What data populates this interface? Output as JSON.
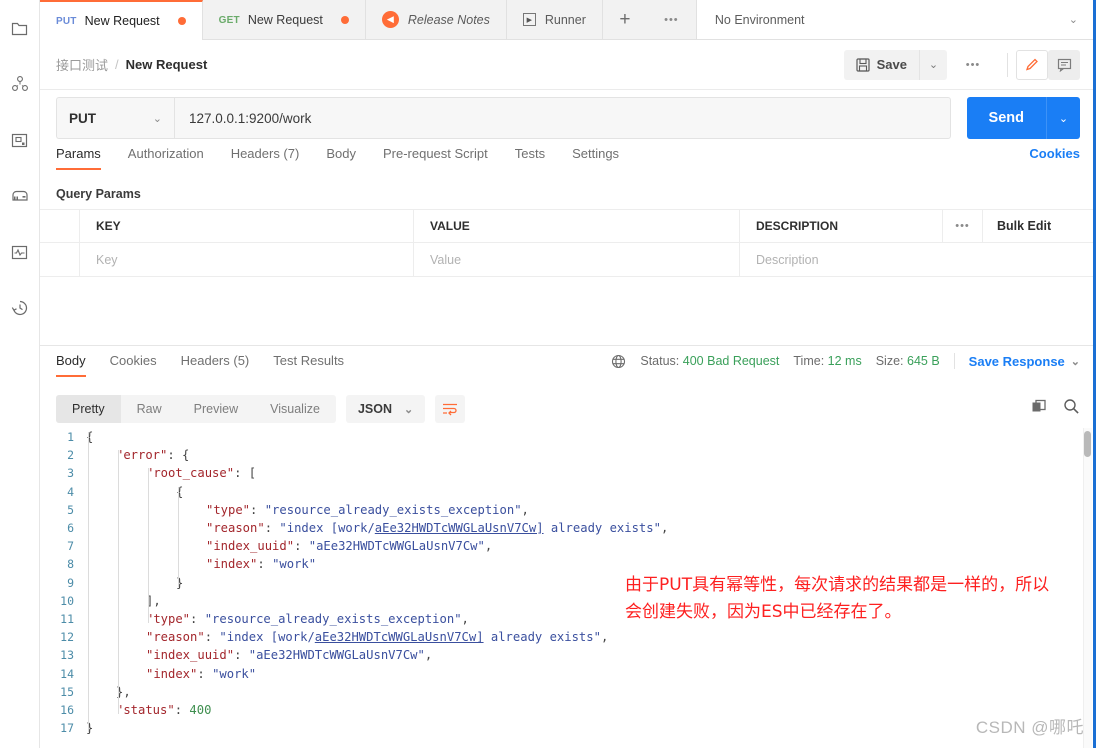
{
  "app": {
    "name": "Postman"
  },
  "sidebar": {
    "items": [
      {
        "name": "file-icon",
        "label": "Files"
      },
      {
        "name": "collections-icon",
        "label": "Collections"
      },
      {
        "name": "apis-icon",
        "label": "APIs"
      },
      {
        "name": "mock-servers-icon",
        "label": "Mock Servers"
      },
      {
        "name": "monitors-icon",
        "label": "Monitors"
      },
      {
        "name": "history-icon",
        "label": "History"
      }
    ]
  },
  "tabbar": {
    "tabs": [
      {
        "method": "PUT",
        "title": "New Request",
        "unsaved": true,
        "active": true
      },
      {
        "method": "GET",
        "title": "New Request",
        "unsaved": true,
        "active": false
      }
    ],
    "release_notes": "Release Notes",
    "runner": "Runner",
    "new_tab": "+",
    "more": "•••",
    "environment": "No Environment"
  },
  "breadcrumb": {
    "collection": "接口测试",
    "separator": "/",
    "request": "New Request",
    "save_label": "Save",
    "more": "•••"
  },
  "request": {
    "method": "PUT",
    "url": "127.0.0.1:9200/work",
    "send_label": "Send",
    "tabs": [
      {
        "label": "Params",
        "active": true
      },
      {
        "label": "Authorization",
        "active": false
      },
      {
        "label": "Headers (7)",
        "active": false
      },
      {
        "label": "Body",
        "active": false
      },
      {
        "label": "Pre-request Script",
        "active": false
      },
      {
        "label": "Tests",
        "active": false
      },
      {
        "label": "Settings",
        "active": false
      }
    ],
    "cookies_link": "Cookies",
    "query_params_title": "Query Params",
    "table": {
      "headers": [
        "KEY",
        "VALUE",
        "DESCRIPTION"
      ],
      "bulk_edit": "Bulk Edit",
      "more": "•••",
      "placeholder_row": [
        "Key",
        "Value",
        "Description"
      ]
    }
  },
  "response": {
    "tabs": [
      {
        "label": "Body",
        "active": true
      },
      {
        "label": "Cookies",
        "active": false
      },
      {
        "label": "Headers (5)",
        "active": false
      },
      {
        "label": "Test Results",
        "active": false
      }
    ],
    "status_label": "Status:",
    "status_value": "400 Bad Request",
    "time_label": "Time:",
    "time_value": "12 ms",
    "size_label": "Size:",
    "size_value": "645 B",
    "save_response": "Save Response",
    "view_modes": [
      {
        "label": "Pretty",
        "active": true
      },
      {
        "label": "Raw",
        "active": false
      },
      {
        "label": "Preview",
        "active": false
      },
      {
        "label": "Visualize",
        "active": false
      }
    ],
    "format": "JSON",
    "body_lines": [
      {
        "n": "1",
        "indent": 0,
        "segs": [
          {
            "t": "{",
            "c": "p"
          }
        ]
      },
      {
        "n": "2",
        "indent": 1,
        "segs": [
          {
            "t": "\"error\"",
            "c": "k"
          },
          {
            "t": ": {",
            "c": "p"
          }
        ]
      },
      {
        "n": "3",
        "indent": 2,
        "segs": [
          {
            "t": "\"root_cause\"",
            "c": "k"
          },
          {
            "t": ": [",
            "c": "p"
          }
        ]
      },
      {
        "n": "4",
        "indent": 3,
        "segs": [
          {
            "t": "{",
            "c": "p"
          }
        ]
      },
      {
        "n": "5",
        "indent": 4,
        "segs": [
          {
            "t": "\"type\"",
            "c": "k"
          },
          {
            "t": ": ",
            "c": "p"
          },
          {
            "t": "\"resource_already_exists_exception\"",
            "c": "s"
          },
          {
            "t": ",",
            "c": "p"
          }
        ]
      },
      {
        "n": "6",
        "indent": 4,
        "segs": [
          {
            "t": "\"reason\"",
            "c": "k"
          },
          {
            "t": ": ",
            "c": "p"
          },
          {
            "t": "\"index [work/",
            "c": "s"
          },
          {
            "t": "aEe32HWDTcWWGLaUsnV7Cw]",
            "c": "s u"
          },
          {
            "t": " already exists\"",
            "c": "s"
          },
          {
            "t": ",",
            "c": "p"
          }
        ]
      },
      {
        "n": "7",
        "indent": 4,
        "segs": [
          {
            "t": "\"index_uuid\"",
            "c": "k"
          },
          {
            "t": ": ",
            "c": "p"
          },
          {
            "t": "\"aEe32HWDTcWWGLaUsnV7Cw\"",
            "c": "s"
          },
          {
            "t": ",",
            "c": "p"
          }
        ]
      },
      {
        "n": "8",
        "indent": 4,
        "segs": [
          {
            "t": "\"index\"",
            "c": "k"
          },
          {
            "t": ": ",
            "c": "p"
          },
          {
            "t": "\"work\"",
            "c": "s"
          }
        ]
      },
      {
        "n": "9",
        "indent": 3,
        "segs": [
          {
            "t": "}",
            "c": "p"
          }
        ]
      },
      {
        "n": "10",
        "indent": 2,
        "segs": [
          {
            "t": "],",
            "c": "p"
          }
        ]
      },
      {
        "n": "11",
        "indent": 2,
        "segs": [
          {
            "t": "\"type\"",
            "c": "k"
          },
          {
            "t": ": ",
            "c": "p"
          },
          {
            "t": "\"resource_already_exists_exception\"",
            "c": "s"
          },
          {
            "t": ",",
            "c": "p"
          }
        ]
      },
      {
        "n": "12",
        "indent": 2,
        "segs": [
          {
            "t": "\"reason\"",
            "c": "k"
          },
          {
            "t": ": ",
            "c": "p"
          },
          {
            "t": "\"index [work/",
            "c": "s"
          },
          {
            "t": "aEe32HWDTcWWGLaUsnV7Cw]",
            "c": "s u"
          },
          {
            "t": " already exists\"",
            "c": "s"
          },
          {
            "t": ",",
            "c": "p"
          }
        ]
      },
      {
        "n": "13",
        "indent": 2,
        "segs": [
          {
            "t": "\"index_uuid\"",
            "c": "k"
          },
          {
            "t": ": ",
            "c": "p"
          },
          {
            "t": "\"aEe32HWDTcWWGLaUsnV7Cw\"",
            "c": "s"
          },
          {
            "t": ",",
            "c": "p"
          }
        ]
      },
      {
        "n": "14",
        "indent": 2,
        "segs": [
          {
            "t": "\"index\"",
            "c": "k"
          },
          {
            "t": ": ",
            "c": "p"
          },
          {
            "t": "\"work\"",
            "c": "s"
          }
        ]
      },
      {
        "n": "15",
        "indent": 1,
        "segs": [
          {
            "t": "},",
            "c": "p"
          }
        ]
      },
      {
        "n": "16",
        "indent": 1,
        "segs": [
          {
            "t": "\"status\"",
            "c": "k"
          },
          {
            "t": ": ",
            "c": "p"
          },
          {
            "t": "400",
            "c": "n"
          }
        ]
      },
      {
        "n": "17",
        "indent": 0,
        "segs": [
          {
            "t": "}",
            "c": "p"
          }
        ]
      }
    ]
  },
  "annotation": {
    "text": "由于PUT具有幂等性，每次请求的结果都是一样的，所以会创建失败，因为ES中已经存在了。",
    "color": "#fd2020"
  },
  "watermark": "CSDN @哪吒",
  "colors": {
    "accent": "#ff6c37",
    "link": "#1a7ef5",
    "send": "#1a7ef5",
    "status_green": "#3aa05a",
    "json_key": "#a3262c",
    "json_string": "#3a4f9e",
    "json_number": "#3f8f4f"
  }
}
